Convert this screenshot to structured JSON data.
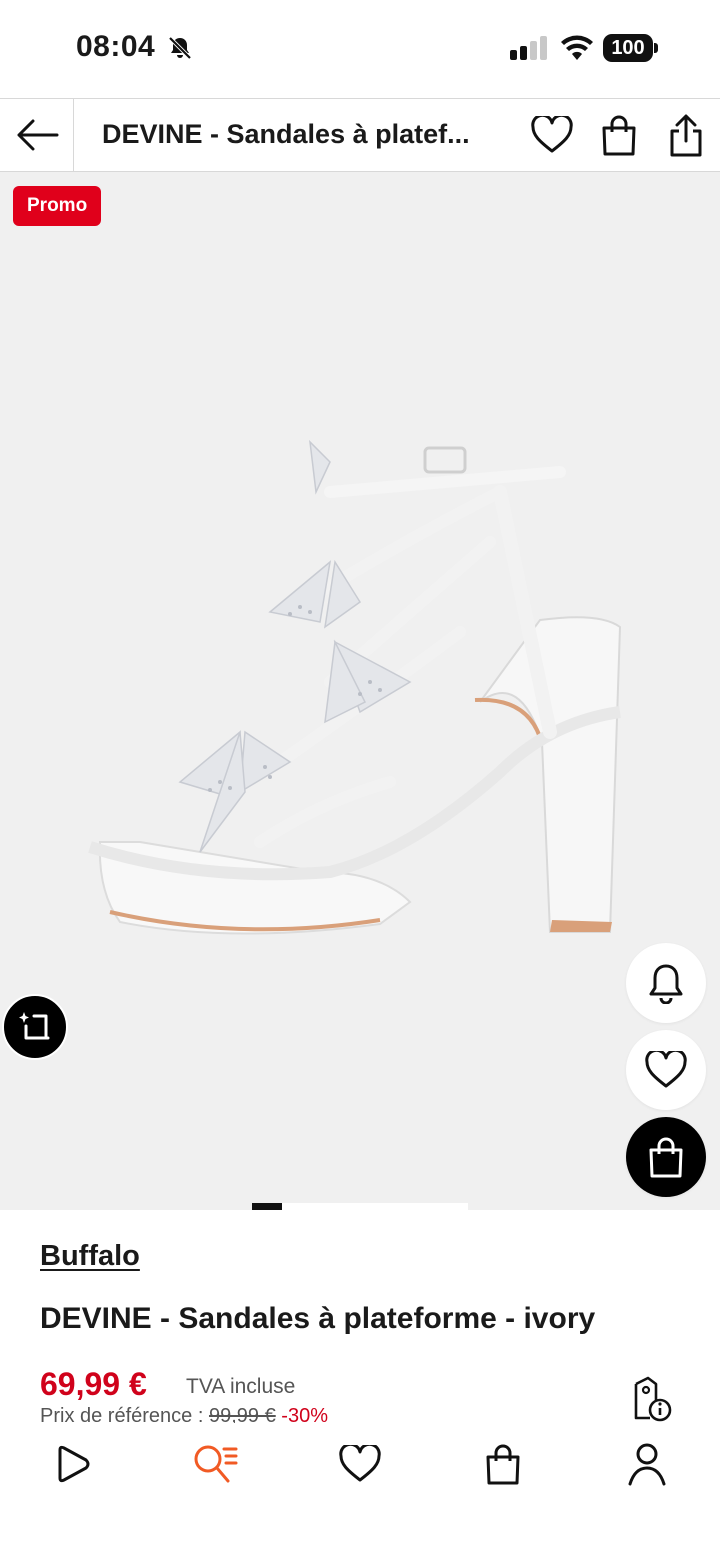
{
  "status_bar": {
    "time": "08:04",
    "battery": "100"
  },
  "header": {
    "title": "DEVINE - Sandales à platef..."
  },
  "hero": {
    "promo_label": "Promo",
    "image_index": 1
  },
  "product": {
    "brand": "Buffalo",
    "name": "DEVINE - Sandales à plateforme - ivory",
    "price": "69,99 €",
    "vat_label": "TVA incluse",
    "reference_label": "Prix de référence :",
    "reference_price": "99,99 €",
    "discount": "-30%"
  },
  "colors": {
    "accent": "#d0021b",
    "promo": "#e0001b",
    "nav_active": "#f15a24"
  },
  "icons": {
    "status": [
      "bell-off-icon",
      "signal-icon",
      "wifi-icon",
      "battery-icon"
    ],
    "header": [
      "back-arrow-icon",
      "heart-icon",
      "bag-icon",
      "share-icon"
    ],
    "floating": [
      "bell-icon",
      "heart-icon",
      "bag-icon",
      "ai-crop-icon"
    ],
    "nav": [
      "play-icon",
      "search-list-icon",
      "heart-icon",
      "bag-icon",
      "user-icon"
    ]
  }
}
